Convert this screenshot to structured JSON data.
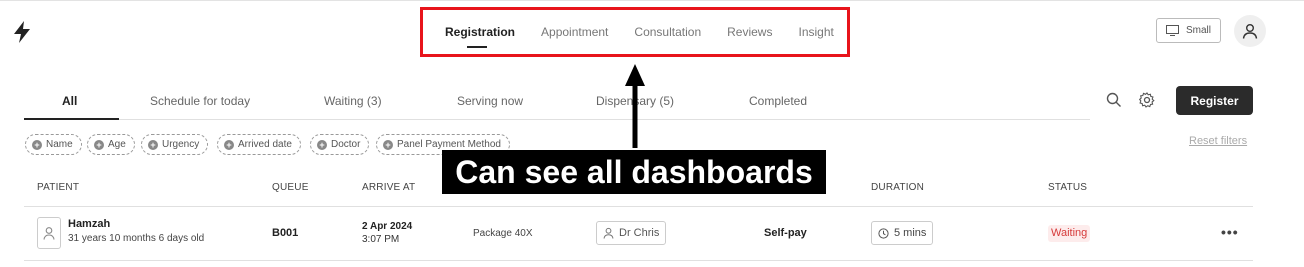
{
  "topnav": {
    "tabs": [
      {
        "label": "Registration",
        "active": true
      },
      {
        "label": "Appointment",
        "active": false
      },
      {
        "label": "Consultation",
        "active": false
      },
      {
        "label": "Reviews",
        "active": false
      },
      {
        "label": "Insight",
        "active": false
      }
    ],
    "size_label": "Small"
  },
  "subtabs": [
    "All",
    "Schedule for today",
    "Waiting (3)",
    "Serving now",
    "Dispensary (5)",
    "Completed"
  ],
  "register_label": "Register",
  "filters": [
    "Name",
    "Age",
    "Urgency",
    "Arrived date",
    "Doctor",
    "Panel Payment Method"
  ],
  "reset_label": "Reset filters",
  "annotation": "Can see all dashboards",
  "table": {
    "headers": {
      "patient": "PATIENT",
      "queue": "QUEUE",
      "arrive": "ARRIVE AT",
      "duration": "DURATION",
      "status": "STATUS"
    },
    "rows": [
      {
        "name": "Hamzah",
        "age": "31 years 10 months 6 days old",
        "queue": "B001",
        "arrive_date": "2 Apr 2024",
        "arrive_time": "3:07 PM",
        "package": "Package 40X",
        "doctor": "Dr Chris",
        "payment": "Self-pay",
        "duration": "5 mins",
        "status": "Waiting"
      }
    ]
  },
  "colors": {
    "highlight_border": "#e8141b",
    "status_waiting_text": "#d63a3a",
    "status_waiting_bg": "#fdecec",
    "primary_button": "#2b2b2b"
  }
}
